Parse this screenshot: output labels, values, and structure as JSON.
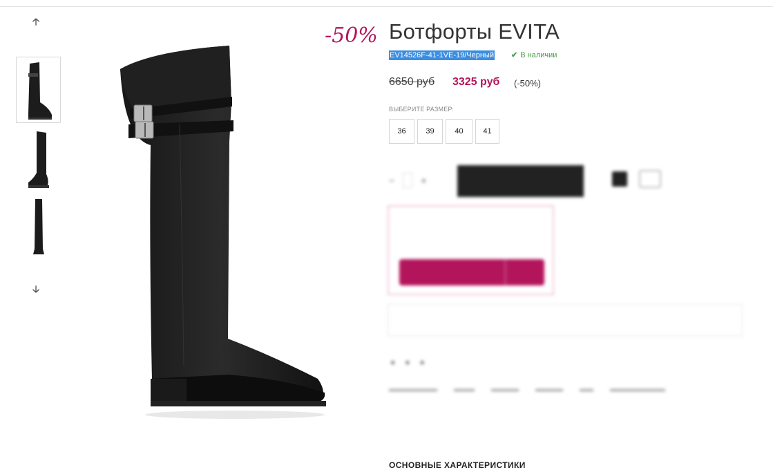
{
  "gallery": {
    "up_icon": "arrow-up-icon",
    "down_icon": "arrow-down-icon",
    "thumbnails": [
      "boot-side",
      "boot-angle",
      "boot-front"
    ]
  },
  "product": {
    "discount_tag": "-50%",
    "title": "Ботфорты EVITA",
    "sku": "EV14526F-41-1VE-19/Черный",
    "stock_text": "В наличии",
    "old_price": "6650 руб",
    "new_price": "3325 руб",
    "discount_pct": "(-50%)",
    "size_label": "ВЫБЕРИТЕ РАЗМЕР:",
    "sizes": [
      "36",
      "39",
      "40",
      "41"
    ],
    "section_heading": "ОСНОВНЫЕ ХАРАКТЕРИСТИКИ"
  },
  "colors": {
    "accent": "#b3155c",
    "in_stock": "#4a9a4a",
    "selection": "#3b8de0"
  }
}
